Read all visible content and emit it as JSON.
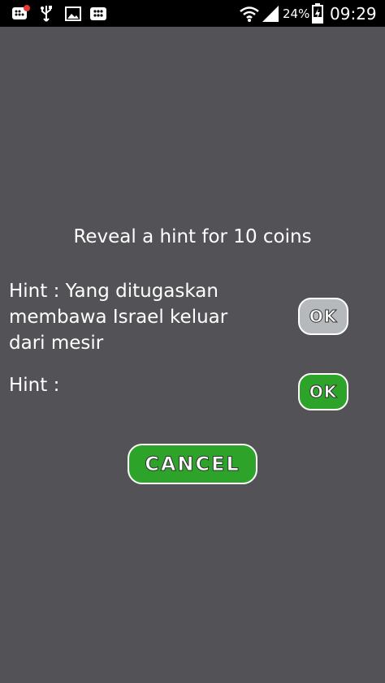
{
  "status_bar": {
    "battery_percent": "24%",
    "time": "09:29",
    "left_icons": [
      "bbm-notification-icon",
      "usb-icon",
      "image-icon",
      "bbm-icon"
    ],
    "right_icons": [
      "wifi-icon",
      "signal-icon",
      "battery-charging-icon"
    ]
  },
  "dialog": {
    "title": "Reveal a hint for 10 coins",
    "hints": [
      {
        "text": "Hint : Yang ditugaskan\nmembawa Israel keluar\ndari mesir",
        "button_label": "OK",
        "enabled": false
      },
      {
        "text": "Hint :",
        "button_label": "OK",
        "enabled": true
      }
    ],
    "cancel_label": "CANCEL"
  },
  "colors": {
    "background": "#535257",
    "status_bar": "#000000",
    "button_green": "#2ea32a",
    "button_gray": "#b6b9bc"
  }
}
